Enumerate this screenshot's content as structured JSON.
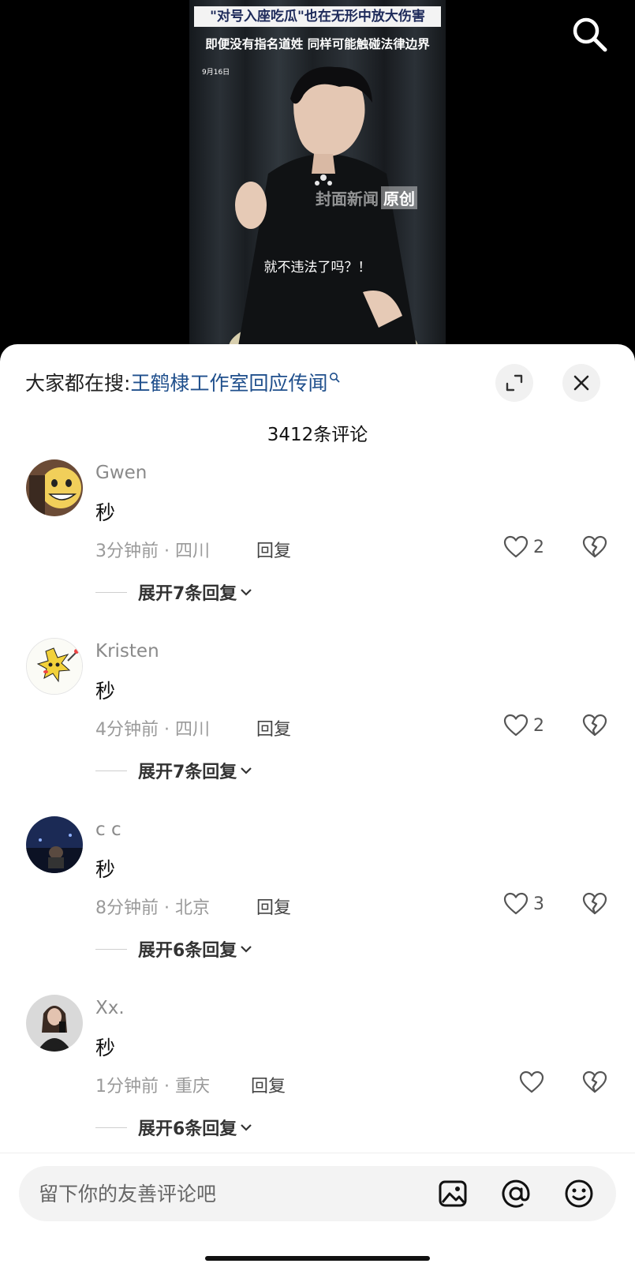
{
  "video": {
    "headline_line1": "\"对号入座吃瓜\"也在无形中放大伤害",
    "headline_line2": "即便没有指名道姓 同样可能触碰法律边界",
    "date": "9月16日",
    "watermark_text": "封面新闻",
    "watermark_badge": "原创",
    "subtitle": "就不违法了吗？！",
    "search_icon": "search-icon"
  },
  "sheet": {
    "trend_prefix": "大家都在搜:",
    "trend_topic": "王鹤棣工作室回应传闻",
    "expand_icon": "expand-icon",
    "close_icon": "close-icon",
    "comment_count": "3412条评论"
  },
  "comments": [
    {
      "user": "Gwen",
      "text": "秒",
      "time": "3分钟前",
      "location": "四川",
      "meta": "3分钟前 · 四川",
      "reply": "回复",
      "likes": "2",
      "expand": "展开7条回复",
      "avatar_color": "#e9c35a"
    },
    {
      "user": "Kristen",
      "text": "秒",
      "time": "4分钟前",
      "location": "四川",
      "meta": "4分钟前 · 四川",
      "reply": "回复",
      "likes": "2",
      "expand": "展开7条回复",
      "avatar_color": "#f2d13a"
    },
    {
      "user": "c c",
      "text": "秒",
      "time": "8分钟前",
      "location": "北京",
      "meta": "8分钟前 · 北京",
      "reply": "回复",
      "likes": "3",
      "expand": "展开6条回复",
      "avatar_color": "#1b2a55"
    },
    {
      "user": "Xx.",
      "text": "秒",
      "time": "1分钟前",
      "location": "重庆",
      "meta": "1分钟前 · 重庆",
      "reply": "回复",
      "likes": "",
      "expand": "展开6条回复",
      "avatar_color": "#2a2a2a"
    }
  ],
  "input": {
    "placeholder": "留下你的友善评论吧",
    "icons": [
      "image-icon",
      "at-icon",
      "emoji-icon"
    ]
  }
}
